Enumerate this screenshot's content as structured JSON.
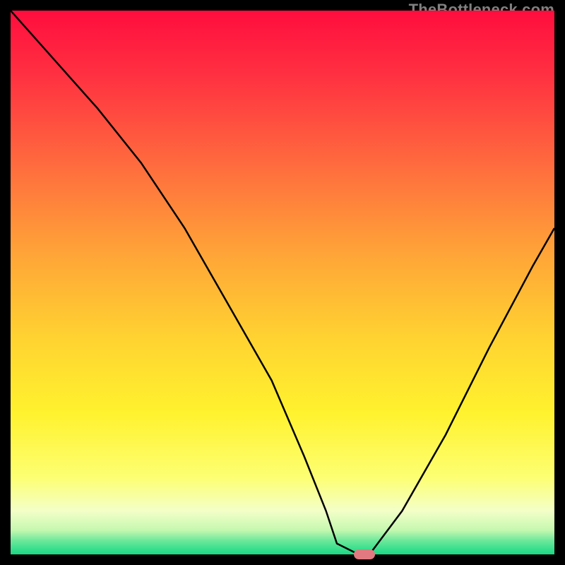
{
  "watermark": "TheBottleneck.com",
  "chart_data": {
    "type": "line",
    "title": "",
    "xlabel": "",
    "ylabel": "",
    "xlim": [
      0,
      100
    ],
    "ylim": [
      0,
      100
    ],
    "series": [
      {
        "name": "curve",
        "x": [
          0,
          8,
          16,
          24,
          32,
          40,
          48,
          54,
          58,
          60,
          64,
          66,
          72,
          80,
          88,
          96,
          100
        ],
        "values": [
          100,
          91,
          82,
          72,
          60,
          46,
          32,
          18,
          8,
          2,
          0,
          0,
          8,
          22,
          38,
          53,
          60
        ]
      }
    ],
    "marker": {
      "x": 65,
      "y": 0
    },
    "gradient_stops": [
      {
        "offset": 0.0,
        "color": "#ff0d3e"
      },
      {
        "offset": 0.12,
        "color": "#ff3141"
      },
      {
        "offset": 0.28,
        "color": "#ff6a3e"
      },
      {
        "offset": 0.44,
        "color": "#ffa238"
      },
      {
        "offset": 0.6,
        "color": "#ffd231"
      },
      {
        "offset": 0.74,
        "color": "#fff22e"
      },
      {
        "offset": 0.86,
        "color": "#fdff74"
      },
      {
        "offset": 0.92,
        "color": "#f3ffc8"
      },
      {
        "offset": 0.955,
        "color": "#c6f8b0"
      },
      {
        "offset": 0.975,
        "color": "#6be89a"
      },
      {
        "offset": 1.0,
        "color": "#18d884"
      }
    ],
    "curve_color": "#000000"
  }
}
